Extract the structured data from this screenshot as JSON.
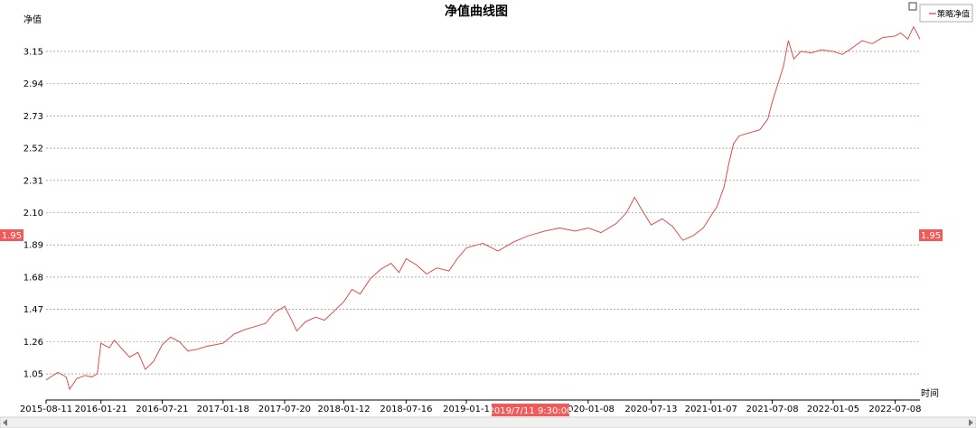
{
  "chart_data": {
    "type": "line",
    "title": "净值曲线图",
    "ylabel": "净值",
    "xlabel": "时间",
    "ylim": [
      0.88,
      3.32
    ],
    "yticks": [
      1.05,
      1.26,
      1.47,
      1.68,
      1.89,
      2.1,
      2.31,
      2.52,
      2.73,
      2.94,
      3.15
    ],
    "ytick_labels": [
      "1.05",
      "1.26",
      "1.47",
      "1.68",
      "1.89",
      "2.10",
      "2.31",
      "2.52",
      "2.73",
      "2.94",
      "3.15"
    ],
    "xlim": [
      "2015-08-11",
      "2022-09-20"
    ],
    "xtick_labels": [
      "2015-08-11",
      "2016-01-21",
      "2016-07-21",
      "2017-01-18",
      "2017-07-20",
      "2018-01-12",
      "2018-07-16",
      "2019-01-1",
      "2020-01-08",
      "2020-07-13",
      "2021-01-07",
      "2021-07-08",
      "2022-01-05",
      "2022-07-08"
    ],
    "xtick_dates": [
      "2015-08-11",
      "2016-01-21",
      "2016-07-21",
      "2017-01-18",
      "2017-07-20",
      "2018-01-12",
      "2018-07-16",
      "2019-01-11",
      "2020-01-08",
      "2020-07-13",
      "2021-01-07",
      "2021-07-08",
      "2022-01-05",
      "2022-07-08"
    ],
    "grid": true,
    "legend_position": "top-right",
    "series": [
      {
        "name": "策略净值",
        "color": "#e03b3b",
        "points": [
          [
            "2015-08-11",
            1.01
          ],
          [
            "2015-09-15",
            1.06
          ],
          [
            "2015-10-10",
            1.03
          ],
          [
            "2015-10-20",
            0.95
          ],
          [
            "2015-11-10",
            1.02
          ],
          [
            "2015-12-05",
            1.04
          ],
          [
            "2015-12-25",
            1.03
          ],
          [
            "2016-01-10",
            1.05
          ],
          [
            "2016-01-21",
            1.25
          ],
          [
            "2016-02-15",
            1.22
          ],
          [
            "2016-03-01",
            1.27
          ],
          [
            "2016-03-25",
            1.21
          ],
          [
            "2016-04-15",
            1.16
          ],
          [
            "2016-05-10",
            1.19
          ],
          [
            "2016-06-01",
            1.08
          ],
          [
            "2016-06-25",
            1.13
          ],
          [
            "2016-07-21",
            1.24
          ],
          [
            "2016-08-15",
            1.29
          ],
          [
            "2016-09-10",
            1.26
          ],
          [
            "2016-10-05",
            1.2
          ],
          [
            "2016-11-01",
            1.21
          ],
          [
            "2016-12-01",
            1.23
          ],
          [
            "2017-01-18",
            1.25
          ],
          [
            "2017-02-20",
            1.31
          ],
          [
            "2017-03-25",
            1.34
          ],
          [
            "2017-04-25",
            1.36
          ],
          [
            "2017-05-25",
            1.38
          ],
          [
            "2017-06-20",
            1.45
          ],
          [
            "2017-07-20",
            1.49
          ],
          [
            "2017-08-10",
            1.4
          ],
          [
            "2017-08-25",
            1.33
          ],
          [
            "2017-09-20",
            1.39
          ],
          [
            "2017-10-20",
            1.42
          ],
          [
            "2017-11-15",
            1.4
          ],
          [
            "2017-12-10",
            1.45
          ],
          [
            "2018-01-12",
            1.52
          ],
          [
            "2018-02-05",
            1.6
          ],
          [
            "2018-03-01",
            1.57
          ],
          [
            "2018-04-01",
            1.67
          ],
          [
            "2018-05-01",
            1.73
          ],
          [
            "2018-06-01",
            1.77
          ],
          [
            "2018-06-25",
            1.71
          ],
          [
            "2018-07-16",
            1.8
          ],
          [
            "2018-08-15",
            1.76
          ],
          [
            "2018-09-15",
            1.7
          ],
          [
            "2018-10-15",
            1.74
          ],
          [
            "2018-11-20",
            1.72
          ],
          [
            "2018-12-15",
            1.8
          ],
          [
            "2019-01-11",
            1.87
          ],
          [
            "2019-03-01",
            1.9
          ],
          [
            "2019-04-15",
            1.85
          ],
          [
            "2019-06-01",
            1.91
          ],
          [
            "2019-07-15",
            1.95
          ],
          [
            "2019-09-01",
            1.98
          ],
          [
            "2019-10-15",
            2.0
          ],
          [
            "2019-12-01",
            1.98
          ],
          [
            "2020-01-08",
            2.0
          ],
          [
            "2020-02-15",
            1.97
          ],
          [
            "2020-04-01",
            2.03
          ],
          [
            "2020-05-01",
            2.1
          ],
          [
            "2020-05-25",
            2.2
          ],
          [
            "2020-06-15",
            2.12
          ],
          [
            "2020-07-13",
            2.02
          ],
          [
            "2020-08-15",
            2.06
          ],
          [
            "2020-09-15",
            2.01
          ],
          [
            "2020-10-15",
            1.92
          ],
          [
            "2020-11-15",
            1.95
          ],
          [
            "2020-12-15",
            2.0
          ],
          [
            "2021-01-07",
            2.08
          ],
          [
            "2021-01-25",
            2.14
          ],
          [
            "2021-02-15",
            2.27
          ],
          [
            "2021-03-01",
            2.42
          ],
          [
            "2021-03-15",
            2.55
          ],
          [
            "2021-04-01",
            2.6
          ],
          [
            "2021-05-01",
            2.62
          ],
          [
            "2021-06-01",
            2.64
          ],
          [
            "2021-06-25",
            2.71
          ],
          [
            "2021-07-08",
            2.82
          ],
          [
            "2021-07-25",
            2.94
          ],
          [
            "2021-08-10",
            3.05
          ],
          [
            "2021-08-25",
            3.22
          ],
          [
            "2021-09-10",
            3.1
          ],
          [
            "2021-10-01",
            3.15
          ],
          [
            "2021-11-01",
            3.14
          ],
          [
            "2021-12-01",
            3.16
          ],
          [
            "2022-01-05",
            3.15
          ],
          [
            "2022-02-01",
            3.13
          ],
          [
            "2022-03-01",
            3.17
          ],
          [
            "2022-04-01",
            3.22
          ],
          [
            "2022-05-01",
            3.2
          ],
          [
            "2022-06-01",
            3.24
          ],
          [
            "2022-07-08",
            3.25
          ],
          [
            "2022-07-25",
            3.27
          ],
          [
            "2022-08-15",
            3.23
          ],
          [
            "2022-09-01",
            3.31
          ],
          [
            "2022-09-20",
            3.23
          ]
        ]
      }
    ],
    "crosshair": {
      "date": "2019/7/11 9:30:00",
      "value": "1.95"
    }
  },
  "colors": {
    "series": "#e03b3b",
    "badge": "#f25a5a"
  }
}
